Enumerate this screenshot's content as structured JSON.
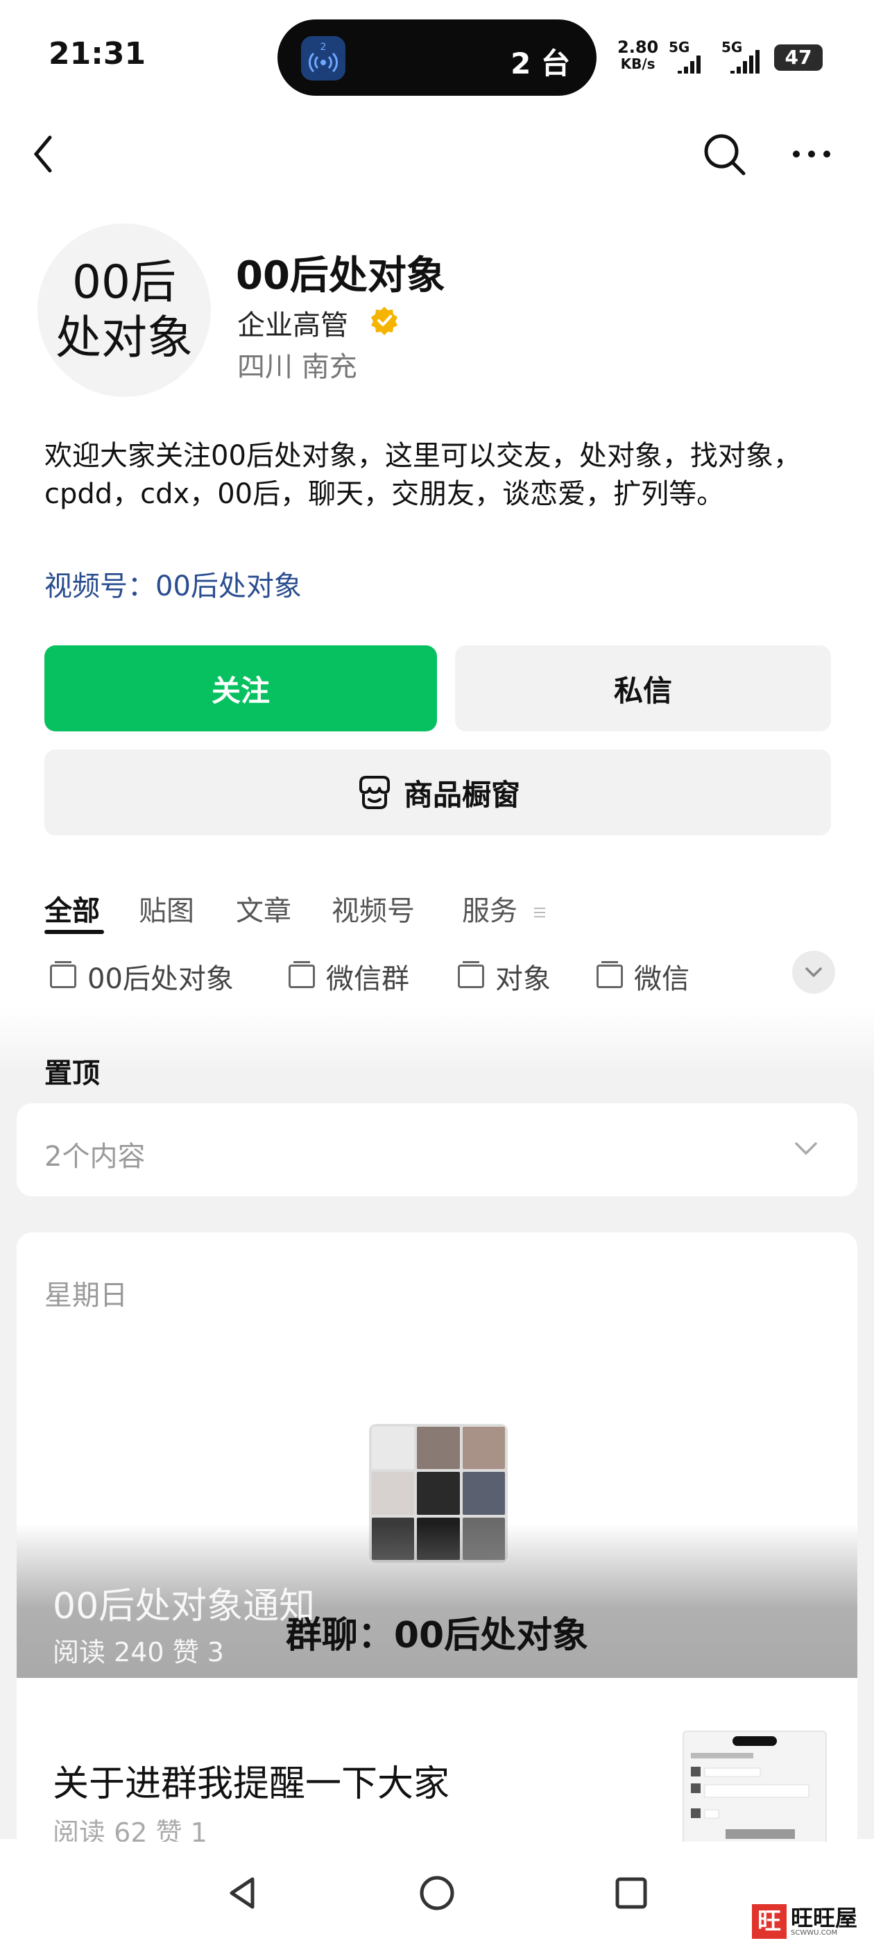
{
  "status_bar": {
    "time": "21:31",
    "island_badge": "2",
    "island_text": "2 台",
    "net_speed": "2.80",
    "net_unit": "KB/s",
    "signal1": "5G",
    "signal2": "5G",
    "battery": "47"
  },
  "profile": {
    "avatar_line1": "00后",
    "avatar_line2": "处对象",
    "name": "00后处对象",
    "title": "企业高管",
    "location": "四川 南充",
    "description": "欢迎大家关注00后处对象，这里可以交友，处对象，找对象，cpdd，cdx，00后，聊天，交朋友，谈恋爱，扩列等。",
    "video_link": "视频号：00后处对象"
  },
  "actions": {
    "follow": "关注",
    "message": "私信",
    "shop": "商品橱窗"
  },
  "tabs": [
    "全部",
    "贴图",
    "文章",
    "视频号",
    "服务"
  ],
  "categories": [
    "00后处对象",
    "微信群",
    "对象",
    "微信"
  ],
  "pinned": {
    "label": "置顶",
    "count": "2个内容"
  },
  "posts": [
    {
      "date": "星期日",
      "overlay_label": "群聊：00后处对象",
      "title": "00后处对象通知",
      "stats": "阅读 240  赞 3"
    },
    {
      "title": "关于进群我提醒一下大家",
      "stats": "阅读 62  赞 1"
    }
  ],
  "watermark": {
    "mark": "旺",
    "text": "旺旺屋",
    "site": "SCWWU.COM"
  },
  "colors": {
    "primary_green": "#07c160",
    "link_blue": "#2a4d8f",
    "verified_gold": "#f5b400"
  }
}
